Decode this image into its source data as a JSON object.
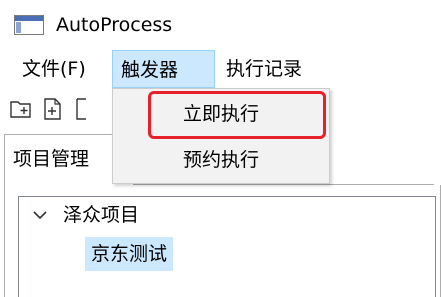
{
  "window": {
    "title": "AutoProcess",
    "icon": "window-app-icon"
  },
  "menubar": {
    "items": [
      {
        "label": "文件(F)"
      },
      {
        "label": "触发器"
      },
      {
        "label": "执行记录"
      }
    ]
  },
  "toolbar": {
    "icons": [
      "new-folder-icon",
      "new-file-icon",
      "toolbar-icon-partial"
    ]
  },
  "tabs": [
    {
      "label": "项目管理"
    }
  ],
  "tree": {
    "root": {
      "label": "泽众项目",
      "expanded": true
    },
    "children": [
      {
        "label": "京东测试",
        "selected": true
      }
    ]
  },
  "dropdown": {
    "items": [
      {
        "label": "立即执行",
        "highlighted": true
      },
      {
        "label": "预约执行"
      }
    ]
  },
  "colors": {
    "menu_active_bg": "#cce8ff",
    "selection_bg": "#cce8ff",
    "highlight_border": "#e8202a",
    "dropdown_bg": "#f2f2f2"
  }
}
